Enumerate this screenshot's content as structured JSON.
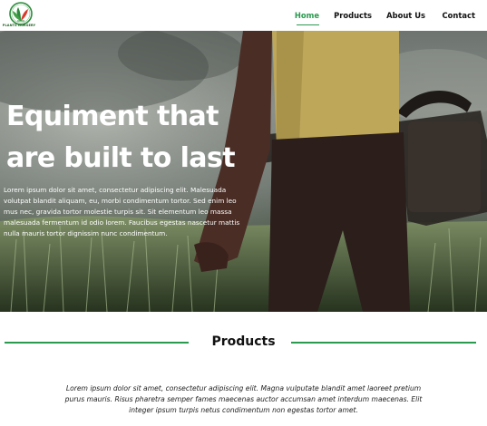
{
  "header": {
    "logo_text": "PLANTS NURSERY",
    "nav": [
      {
        "label": "Home",
        "active": true
      },
      {
        "label": "Products",
        "active": false
      },
      {
        "label": "About Us",
        "active": false
      },
      {
        "label": "Contact",
        "active": false
      }
    ],
    "accent_color": "#2a9a4f"
  },
  "hero": {
    "title_line1": "Equiment that",
    "title_line2": "are built to last",
    "description": "Lorem ipsum dolor sit amet, consectetur adipiscing elit. Malesuada volutpat blandit aliquam, eu, morbi condimentum tortor. Sed enim leo mus nec, gravida tortor molestie turpis sit. Sit elementum leo massa malesuada fermentum id odio lorem. Faucibus egestas nascetur mattis nulla mauris tortor dignissim nunc condimentum."
  },
  "products": {
    "title": "Products",
    "description": "Lorem ipsum dolor sit amet, consectetur adipiscing elit. Magna vulputate blandit amet laoreet pretium purus mauris. Risus pharetra semper fames maecenas auctor accumsan amet interdum maecenas. Elit integer ipsum turpis netus condimentum non egestas tortor amet."
  }
}
